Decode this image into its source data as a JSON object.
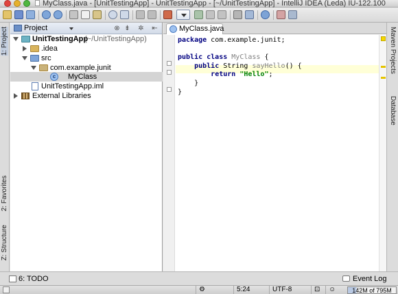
{
  "window": {
    "title": "MyClass.java - [UnitTestingApp] - UnitTestingApp - [~/UnitTestingApp] - IntelliJ IDEA (Leda) IU-122.100"
  },
  "left_stripe": {
    "project_tab": "1: Project",
    "favorites_tab": "2: Favorites",
    "structure_tab": "Z: Structure"
  },
  "right_stripe": {
    "maven_tab": "Maven Projects",
    "database_tab": "Database"
  },
  "project_panel": {
    "title": "Project",
    "tree": [
      {
        "label": "UnitTestingApp",
        "suffix": "(~/UnitTestingApp)"
      },
      {
        "label": ".idea"
      },
      {
        "label": "src"
      },
      {
        "label": "com.example.junit"
      },
      {
        "label": "MyClass"
      },
      {
        "label": "UnitTestingApp.iml"
      },
      {
        "label": "External Libraries"
      }
    ]
  },
  "editor": {
    "tab_label": "MyClass.java",
    "code": {
      "line1": {
        "kw": "package",
        "rest": " com.example.junit;"
      },
      "line3": {
        "kw1": "public class",
        "cls": "MyClass",
        "rest": " {"
      },
      "line4": {
        "kw1": "public",
        "type": "String",
        "method": "sayHello",
        "rest": "() {"
      },
      "line5": {
        "kw": "return",
        "str": "\"Hello\"",
        "rest": ";"
      },
      "line6": "}",
      "line7": "}"
    }
  },
  "bottom_tools": {
    "todo": "6: TODO",
    "event_log": "Event Log"
  },
  "status_bar": {
    "position": "5:24",
    "encoding": "UTF-8",
    "memory": "142M of 795M",
    "memory_used_fraction": 0.18
  },
  "colors": {
    "keyword": "#000080",
    "string": "#008000",
    "caret_line": "#ffffd7",
    "selection": "#d4d4d4"
  }
}
